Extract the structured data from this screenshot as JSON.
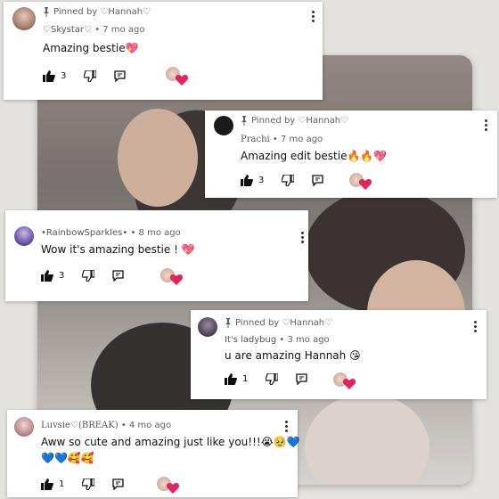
{
  "comments": [
    {
      "pinned": "Pinned by ♡Hannah♡",
      "author": "♡Skystar♡",
      "age": "• 7 mo ago",
      "text": "Amazing bestie💖",
      "likes": "3"
    },
    {
      "pinned": "Pinned by ♡Hannah♡",
      "author": "Prachi",
      "age": "• 7 mo ago",
      "text": "Amazing edit bestie🔥🔥💖",
      "likes": "3"
    },
    {
      "author": "•RainbowSparkles•",
      "age": "• 8 mo ago",
      "text": "Wow it's amazing bestie ! 💖",
      "likes": "3"
    },
    {
      "pinned": "Pinned by ♡Hannah♡",
      "author": "It's ladybug",
      "age": "• 3 mo ago",
      "text": "u are amazing Hannah 😘",
      "likes": "1"
    },
    {
      "author": "Luvsie♡(BREAK)",
      "age": "• 4 mo ago",
      "text": "Aww so cute and amazing just like you!!!😭🥹💙",
      "text2": "💙💙🥰🥰",
      "likes": "1"
    }
  ],
  "colors": {
    "heart": "#e0245e",
    "text": "#0f0f0f",
    "meta": "#606060"
  },
  "icons": [
    "pin-icon",
    "thumbs-up-icon",
    "thumbs-down-icon",
    "reply-icon",
    "more-options-icon",
    "creator-heart-icon"
  ]
}
